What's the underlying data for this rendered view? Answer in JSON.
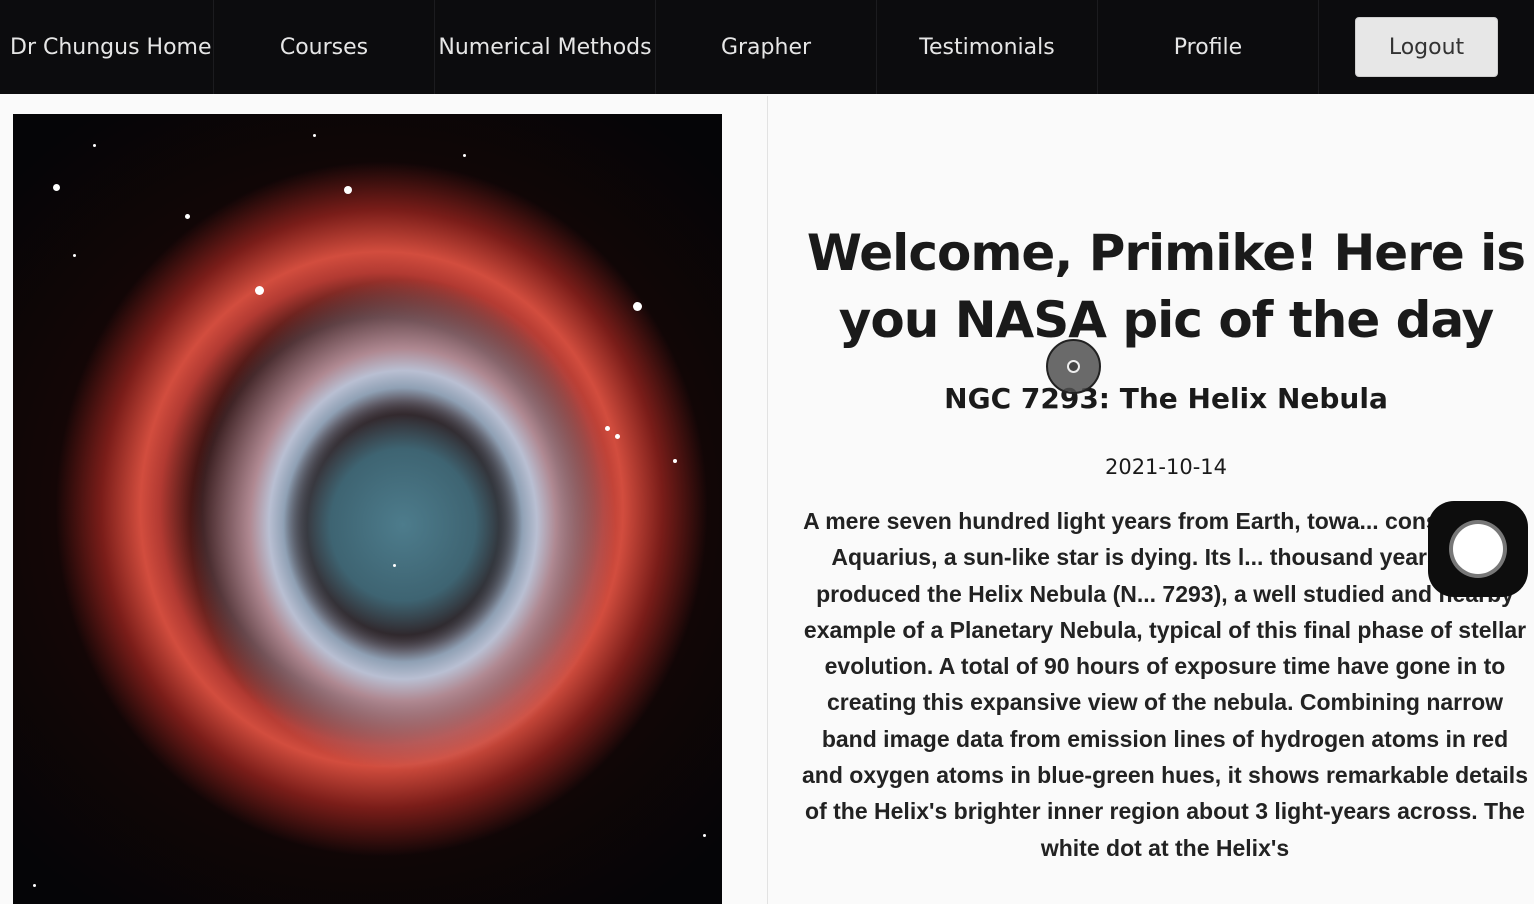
{
  "nav": {
    "home": "Dr Chungus Home",
    "courses": "Courses",
    "numerical_methods": "Numerical Methods",
    "grapher": "Grapher",
    "testimonials": "Testimonials",
    "profile": "Profile",
    "logout": "Logout"
  },
  "main": {
    "headline": "Welcome, Primike! Here is you NASA pic of the day",
    "apod_title": "NGC 7293: The Helix Nebula",
    "apod_date": "2021-10-14",
    "apod_description": "A mere seven hundred light years from Earth, towa... constellation Aquarius, a sun-like star is dying. Its l... thousand years have produced the Helix Nebula (N... 7293), a well studied and nearby example of a Planetary Nebula, typical of this final phase of stellar evolution. A total of 90 hours of exposure time have gone in to creating this expansive view of the nebula. Combining narrow band image data from emission lines of hydrogen atoms in red and oxygen atoms in blue-green hues, it shows remarkable details of the Helix's brighter inner region about 3 light-years across. The white dot at the Helix's"
  },
  "colors": {
    "nav_bg": "#0c0c0e",
    "nav_text": "#e6e6e6",
    "logout_bg": "#e7e7e7",
    "page_bg": "#fafafa"
  },
  "icons": {
    "cursor_indicator": "click-cursor-icon",
    "recording_indicator": "record-button-icon"
  }
}
